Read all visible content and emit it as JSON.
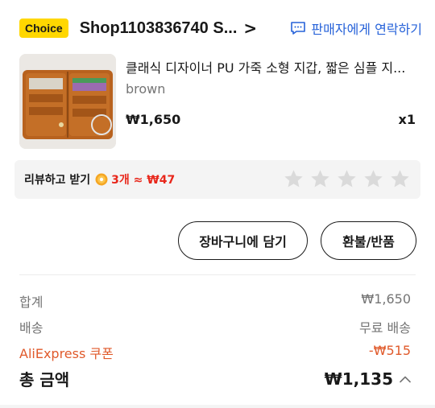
{
  "shop": {
    "badge": "Choice",
    "name": "Shop1103836740 S...",
    "arrow": ">",
    "contact_label": "판매자에게 연락하기"
  },
  "product": {
    "title": "클래식 디자이너 PU 가죽 소형 지갑, 짧은 심플 지...",
    "variant": "brown",
    "price": "₩1,650",
    "quantity": "x1"
  },
  "review": {
    "label": "리뷰하고 받기",
    "reward": "3개 ≈ ₩47",
    "star_count": 5
  },
  "actions": {
    "add_to_cart": "장바구니에 담기",
    "refund": "환불/반품"
  },
  "summary": {
    "subtotal_label": "합계",
    "subtotal_value": "₩1,650",
    "shipping_label": "배송",
    "shipping_value": "무료 배송",
    "coupon_label": "AliExpress 쿠폰",
    "coupon_value": "-₩515",
    "total_label": "총 금액",
    "total_value": "₩1,135"
  },
  "colors": {
    "choice_badge": "#ffd700",
    "link_blue": "#2662d9",
    "coupon_orange": "#e05a2b",
    "reward_red": "#e8271b",
    "wallet_brown": "#b8621e"
  }
}
